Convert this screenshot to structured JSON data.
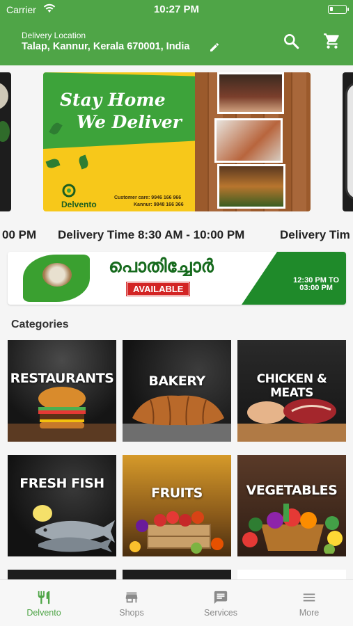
{
  "status_bar": {
    "carrier": "Carrier",
    "time": "10:27 PM"
  },
  "header": {
    "location_label": "Delivery Location",
    "location_value": "Talap, Kannur, Kerala 670001, India",
    "bg_color": "#4fa547"
  },
  "banner": {
    "headline_1": "Stay Home",
    "headline_2": "We Deliver",
    "brand": "Delvento",
    "customer_care": "Customer care: 9946 166 966",
    "kannur_phone": "Kannur: 9848 166 366"
  },
  "ticker": {
    "items": [
      "00 PM",
      "Delivery Time 8:30 AM - 10:00 PM",
      "Delivery Tim"
    ]
  },
  "pothichoru": {
    "title": "പൊതിച്ചോർ",
    "badge": "AVAILABLE",
    "time_line1": "12:30 PM TO",
    "time_line2": "03:00 PM"
  },
  "categories": {
    "heading": "Categories",
    "items": [
      {
        "label": "RESTAURANTS",
        "icon": "burger"
      },
      {
        "label": "BAKERY",
        "icon": "croissant"
      },
      {
        "label": "CHICKEN & MEATS",
        "icon": "meat"
      },
      {
        "label": "FRESH FISH",
        "icon": "fish"
      },
      {
        "label": "FRUITS",
        "icon": "fruit-crate"
      },
      {
        "label": "VEGETABLES",
        "icon": "vegetable-basket"
      }
    ]
  },
  "bottom_nav": {
    "items": [
      {
        "label": "Delvento",
        "icon": "fork-knife-icon",
        "active": true
      },
      {
        "label": "Shops",
        "icon": "shop-icon",
        "active": false
      },
      {
        "label": "Services",
        "icon": "chat-icon",
        "active": false
      },
      {
        "label": "More",
        "icon": "menu-icon",
        "active": false
      }
    ],
    "active_color": "#4fa547",
    "inactive_color": "#8a8a8a"
  }
}
